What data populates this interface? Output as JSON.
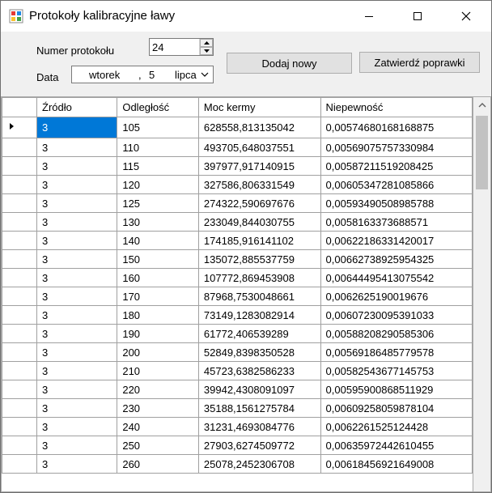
{
  "window": {
    "title": "Protokoły kalibracyjne ławy"
  },
  "form": {
    "protocol_label": "Numer protokołu",
    "protocol_value": "24",
    "date_label": "Data",
    "date_weekday": "wtorek",
    "date_sep": ",",
    "date_day": "5",
    "date_month": "lipca",
    "add_button": "Dodaj nowy",
    "confirm_button": "Zatwierdź poprawki"
  },
  "table": {
    "columns": [
      "Źródło",
      "Odległość",
      "Moc kermy",
      "Niepewność"
    ],
    "rows": [
      [
        "3",
        "105",
        "628558,813135042",
        "0,00574680168168875"
      ],
      [
        "3",
        "110",
        "493705,648037551",
        "0,00569075757330984"
      ],
      [
        "3",
        "115",
        "397977,917140915",
        "0,00587211519208425"
      ],
      [
        "3",
        "120",
        "327586,806331549",
        "0,00605347281085866"
      ],
      [
        "3",
        "125",
        "274322,590697676",
        "0,00593490508985788"
      ],
      [
        "3",
        "130",
        "233049,844030755",
        "0,0058163373688571"
      ],
      [
        "3",
        "140",
        "174185,916141102",
        "0,00622186331420017"
      ],
      [
        "3",
        "150",
        "135072,885537759",
        "0,00662738925954325"
      ],
      [
        "3",
        "160",
        "107772,869453908",
        "0,00644495413075542"
      ],
      [
        "3",
        "170",
        "87968,7530048661",
        "0,0062625190019676"
      ],
      [
        "3",
        "180",
        "73149,1283082914",
        "0,00607230095391033"
      ],
      [
        "3",
        "190",
        "61772,406539289",
        "0,00588208290585306"
      ],
      [
        "3",
        "200",
        "52849,8398350528",
        "0,00569186485779578"
      ],
      [
        "3",
        "210",
        "45723,6382586233",
        "0,00582543677145753"
      ],
      [
        "3",
        "220",
        "39942,4308091097",
        "0,00595900868511929"
      ],
      [
        "3",
        "230",
        "35188,1561275784",
        "0,00609258059878104"
      ],
      [
        "3",
        "240",
        "31231,4693084776",
        "0,0062261525124428"
      ],
      [
        "3",
        "250",
        "27903,6274509772",
        "0,00635972442610455"
      ],
      [
        "3",
        "260",
        "25078,2452306708",
        "0,00618456921649008"
      ]
    ]
  }
}
